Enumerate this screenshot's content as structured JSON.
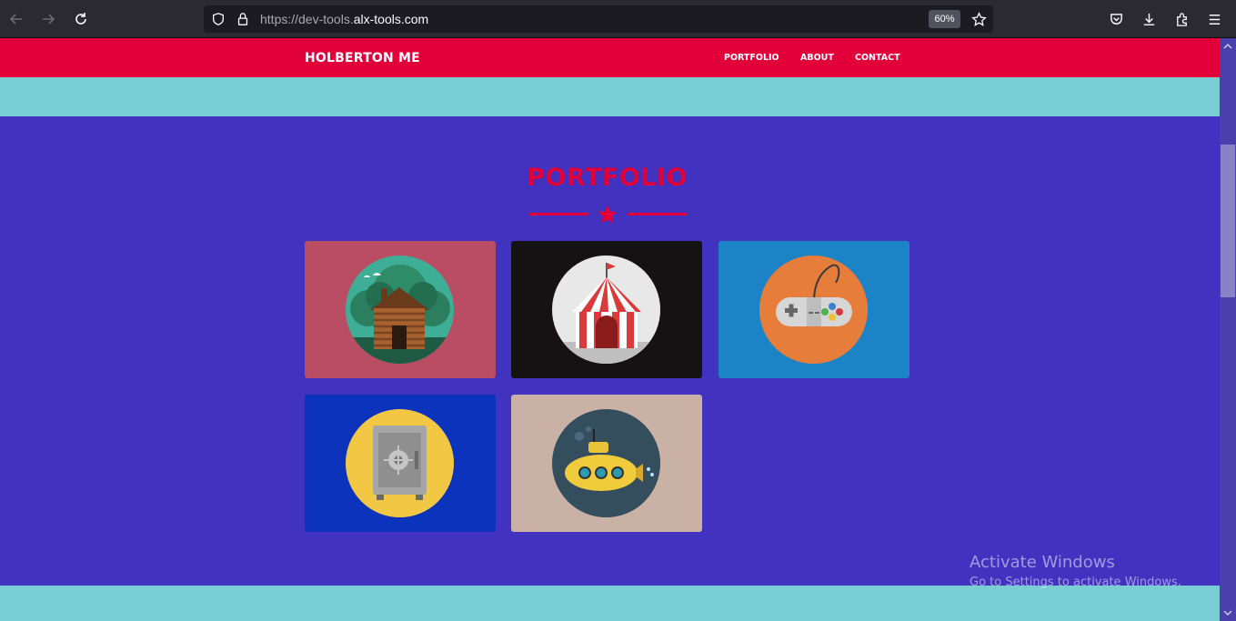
{
  "browser": {
    "url_prefix": "https://dev-tools.",
    "url_domain": "alx-tools.com",
    "zoom": "60%"
  },
  "site": {
    "brand": "HOLBERTON ME",
    "nav": [
      {
        "label": "PORTFOLIO"
      },
      {
        "label": "ABOUT"
      },
      {
        "label": "CONTACT"
      }
    ],
    "colors": {
      "header": "#e1003a",
      "teal": "#79ced3",
      "section_bg": "#4132c0"
    }
  },
  "portfolio": {
    "title": "PORTFOLIO",
    "items": [
      {
        "name": "cabin",
        "bg": "#b94d63"
      },
      {
        "name": "circus",
        "bg": "#161112"
      },
      {
        "name": "game-controller",
        "bg": "#1c83c6"
      },
      {
        "name": "safe",
        "bg": "#0c33bb"
      },
      {
        "name": "submarine",
        "bg": "#c9b1a5"
      }
    ]
  },
  "watermark": {
    "line1": "Activate Windows",
    "line2": "Go to Settings to activate Windows."
  }
}
